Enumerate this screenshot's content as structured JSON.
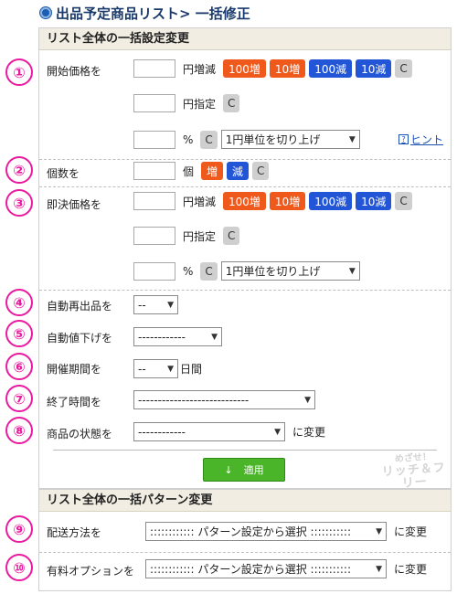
{
  "page": {
    "title": "出品予定商品リスト> 一括修正"
  },
  "bulk_settings": {
    "heading": "リスト全体の一括設定変更",
    "rows": {
      "start_price": {
        "label": "開始価格を",
        "yen_change_unit": "円増減",
        "yen_set_unit": "円指定",
        "percent_unit": "%",
        "buttons": [
          "100増",
          "10増",
          "100減",
          "10減"
        ],
        "clear": "C",
        "rounding_select": "1円単位を切り上げ"
      },
      "quantity": {
        "label": "個数を",
        "unit": "個",
        "inc": "増",
        "dec": "減",
        "clear": "C"
      },
      "buyout_price": {
        "label": "即決価格を",
        "yen_change_unit": "円増減",
        "yen_set_unit": "円指定",
        "percent_unit": "%",
        "buttons": [
          "100増",
          "10増",
          "100減",
          "10減"
        ],
        "clear": "C",
        "rounding_select": "1円単位を切り上げ"
      },
      "auto_relist": {
        "label": "自動再出品を",
        "select": "--"
      },
      "auto_price_down": {
        "label": "自動値下げを",
        "select": "------------"
      },
      "duration": {
        "label": "開催期間を",
        "select": "--",
        "suffix": "日間"
      },
      "end_time": {
        "label": "終了時間を",
        "select": "----------------------------"
      },
      "condition": {
        "label": "商品の状態を",
        "select": "------------",
        "suffix": "に変更"
      }
    },
    "apply_icon": "↓",
    "apply_label": "適用",
    "hint_icon": "?",
    "hint_label": "ヒント"
  },
  "bulk_pattern": {
    "heading": "リスト全体の一括パターン変更",
    "rows": {
      "shipping": {
        "label": "配送方法を",
        "select": ":::::::::::: パターン設定から選択 :::::::::::",
        "suffix": "に変更"
      },
      "paid_options": {
        "label": "有料オプションを",
        "select": ":::::::::::: パターン設定から選択 :::::::::::",
        "suffix": "に変更"
      }
    }
  },
  "watermark": {
    "line1": "めざせ！",
    "line2": "リッチ＆フリー"
  },
  "markers": [
    "①",
    "②",
    "③",
    "④",
    "⑤",
    "⑥",
    "⑦",
    "⑧",
    "⑨",
    "⑩"
  ],
  "colors": {
    "orange": "#ef5a1c",
    "blue": "#2256d6",
    "green": "#4ab529",
    "magenta": "#ea1aa0",
    "heading_bg": "#f1ede2"
  }
}
